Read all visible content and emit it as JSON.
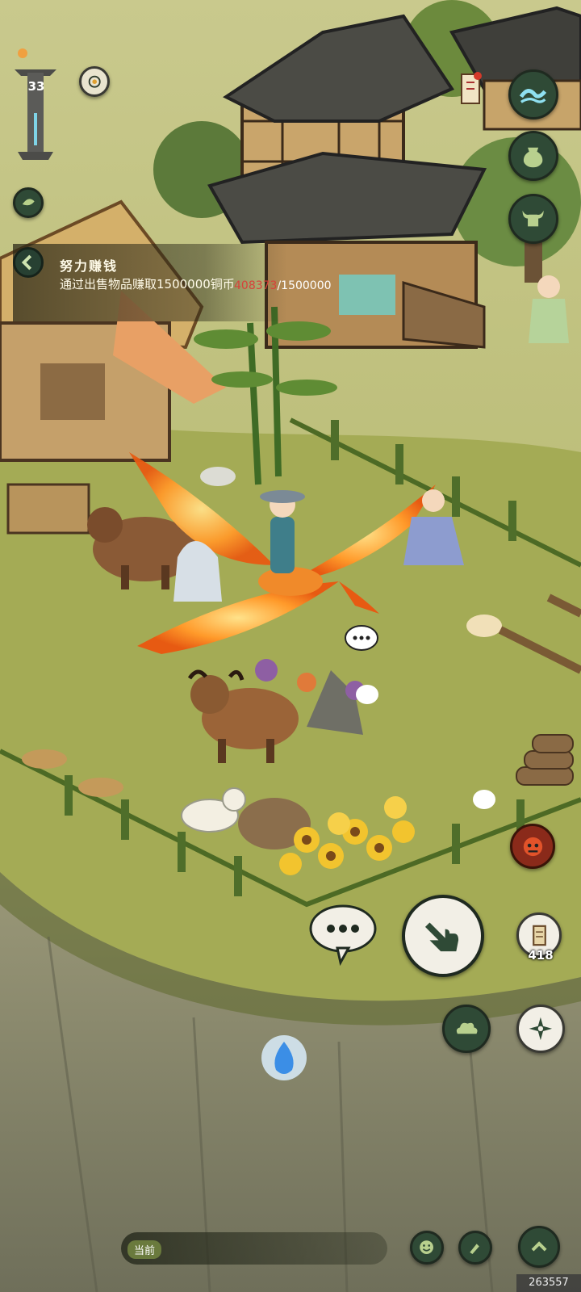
{
  "hud": {
    "level": "33",
    "quest": {
      "title": "努力赚钱",
      "description": "通过出售物品赚取1500000铜币",
      "progress_current": "408373",
      "progress_total": "/1500000"
    },
    "item_count": "418",
    "chat_channel": "当前",
    "watermark": "263557"
  },
  "icons": {
    "top_left": [
      "level-tower-icon",
      "compass-ring-icon",
      "leaf-icon",
      "back-arrow-icon"
    ],
    "top_right": [
      "scroll-notice-icon",
      "water-wave-icon",
      "pouch-icon",
      "ox-head-icon"
    ],
    "bottom_right": [
      "demon-mask-icon",
      "chat-bubble-icon",
      "hand-pointer-icon",
      "map-scroll-icon",
      "cloud-icon",
      "shuriken-icon"
    ],
    "bottom_bar": [
      "smile-icon",
      "brush-icon",
      "chevron-up-icon"
    ]
  },
  "colors": {
    "grass": "#a7ad56",
    "cliff": "#7b7a64",
    "hud_dark": "#2f4a36",
    "progress_red": "#d8423a"
  }
}
